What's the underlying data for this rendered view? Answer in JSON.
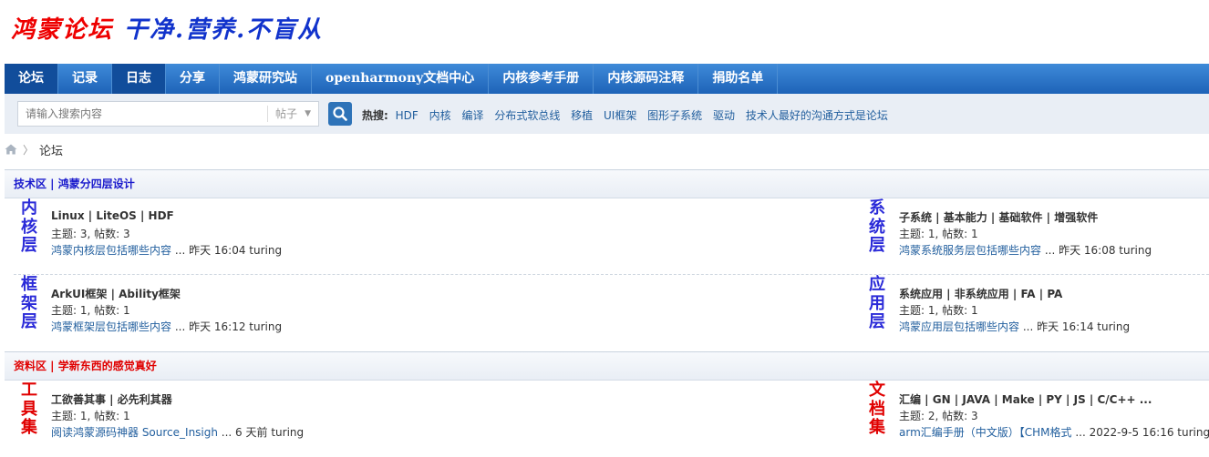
{
  "logo": {
    "part1": "鸿蒙论坛",
    "part2": "干净.营养.不盲从"
  },
  "nav": [
    "论坛",
    "记录",
    "日志",
    "分享",
    "鸿蒙研究站",
    "openharmony文档中心",
    "内核参考手册",
    "内核源码注释",
    "捐助名单"
  ],
  "search": {
    "placeholder": "请输入搜索内容",
    "type": "帖子",
    "hot_label": "热搜:",
    "hot": [
      "HDF",
      "内核",
      "编译",
      "分布式软总线",
      "移植",
      "UI框架",
      "图形子系统",
      "驱动",
      "技术人最好的沟通方式是论坛"
    ]
  },
  "breadcrumb": {
    "current": "论坛"
  },
  "colors": {
    "nav_active": "#114d9b",
    "blue_text": "#2a2ad8",
    "red_text": "#e00000"
  },
  "sections": [
    {
      "title": "技术区 | 鸿蒙分四层设计",
      "forums": [
        {
          "name": "内核层",
          "title": "Linux | LiteOS | HDF",
          "stats": "主题: 3, 帖数: 3",
          "last_thread": "鸿蒙内核层包括哪些内容",
          "last_meta": " ... 昨天 16:04 turing"
        },
        {
          "name": "系统层",
          "title": "子系统 | 基本能力 | 基础软件 | 增强软件",
          "stats": "主题: 1, 帖数: 1",
          "last_thread": "鸿蒙系统服务层包括哪些内容",
          "last_meta": " ... 昨天 16:08 turing"
        },
        {
          "name": "框架层",
          "title": "ArkUI框架 | Ability框架",
          "stats": "主题: 1, 帖数: 1",
          "last_thread": "鸿蒙框架层包括哪些内容",
          "last_meta": " ... 昨天 16:12 turing"
        },
        {
          "name": "应用层",
          "title": "系统应用 | 非系统应用 | FA | PA",
          "stats": "主题: 1, 帖数: 1",
          "last_thread": "鸿蒙应用层包括哪些内容",
          "last_meta": " ... 昨天 16:14 turing"
        }
      ]
    },
    {
      "title": "资料区 | 学新东西的感觉真好",
      "forums": [
        {
          "name": "工具集",
          "title": "工欲善其事 | 必先利其器",
          "stats": "主题: 1, 帖数: 1",
          "last_thread": "阅读鸿蒙源码神器 Source_Insigh",
          "last_meta": " ... 6 天前 turing"
        },
        {
          "name": "文档集",
          "title": "汇编 | GN | JAVA | Make | PY | JS | C/C++ ...",
          "stats": "主题: 2, 帖数: 3",
          "last_thread": "arm汇编手册（中文版）【CHM格式",
          "last_meta": " ... 2022-9-5 16:16 turing"
        }
      ]
    }
  ]
}
